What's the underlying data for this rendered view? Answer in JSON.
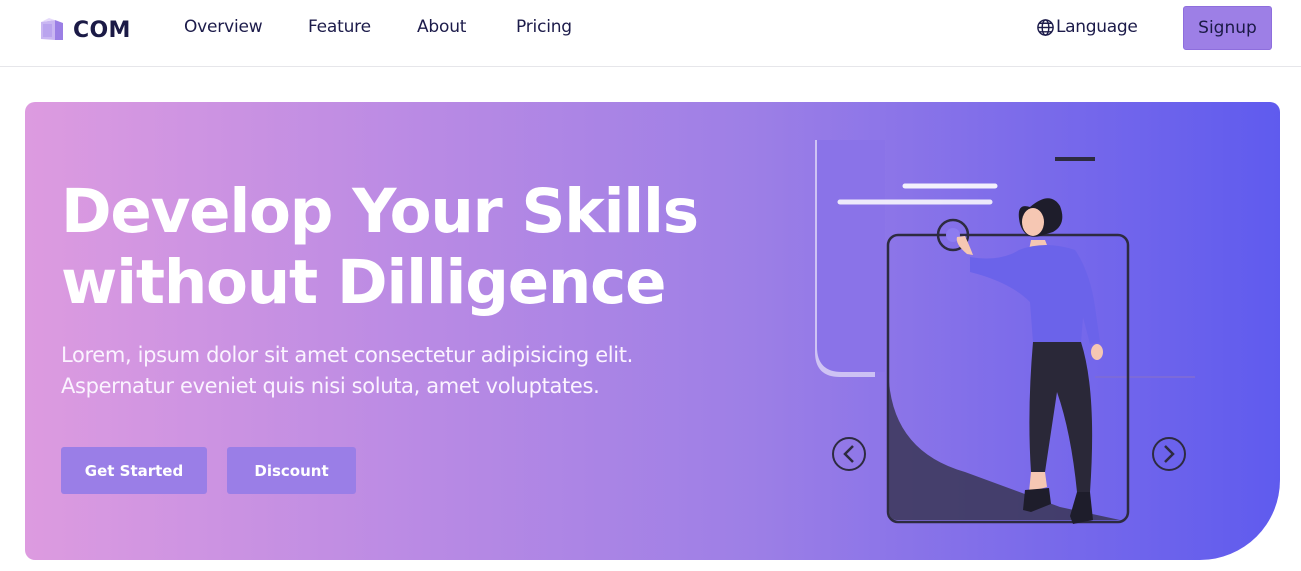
{
  "header": {
    "brand": "COM",
    "nav": [
      "Overview",
      "Feature",
      "About",
      "Pricing"
    ],
    "language_label": "Language",
    "signup_label": "Signup"
  },
  "hero": {
    "title_line1": "Develop Your Skills",
    "title_line2": "without Dilligence",
    "subtitle_line1": "Lorem, ipsum dolor sit amet consectetur adipisicing elit.",
    "subtitle_line2": "Aspernatur eveniet quis nisi soluta, amet voluptates.",
    "primary_button": "Get Started",
    "secondary_button": "Discount"
  },
  "icons": {
    "brand": "cube-logo-icon",
    "language": "globe-icon",
    "prev": "chevron-left-icon",
    "next": "chevron-right-icon"
  },
  "colors": {
    "accent": "#9d7fe6",
    "hero_start": "#dd9be0",
    "hero_end": "#5f5bee",
    "text_dark": "#1b1a46"
  }
}
